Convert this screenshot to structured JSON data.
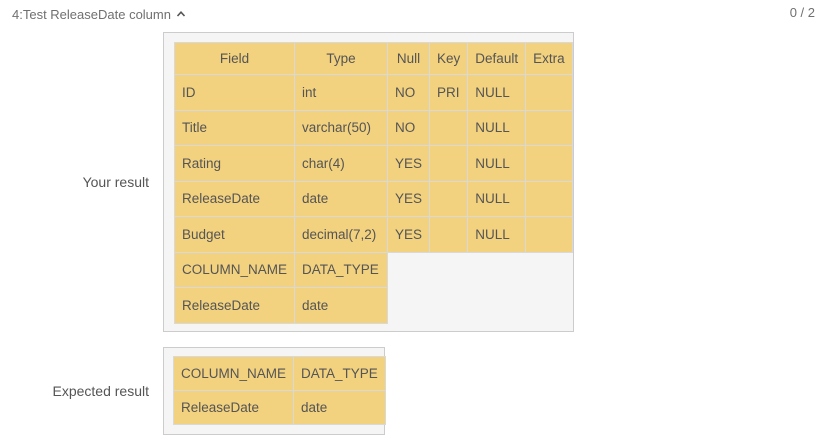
{
  "test": {
    "title": "4:Test ReleaseDate column",
    "score": "0 / 2"
  },
  "your_result": {
    "label": "Your result",
    "table1": {
      "headers": [
        "Field",
        "Type",
        "Null",
        "Key",
        "Default",
        "Extra"
      ],
      "rows": [
        [
          "ID",
          "int",
          "NO",
          "PRI",
          "NULL",
          ""
        ],
        [
          "Title",
          "varchar(50)",
          "NO",
          "",
          "NULL",
          ""
        ],
        [
          "Rating",
          "char(4)",
          "YES",
          "",
          "NULL",
          ""
        ],
        [
          "ReleaseDate",
          "date",
          "YES",
          "",
          "NULL",
          ""
        ],
        [
          "Budget",
          "decimal(7,2)",
          "YES",
          "",
          "NULL",
          ""
        ]
      ]
    },
    "table2": {
      "rows": [
        [
          "COLUMN_NAME",
          "DATA_TYPE"
        ],
        [
          "ReleaseDate",
          "date"
        ]
      ]
    }
  },
  "expected_result": {
    "label": "Expected result",
    "rows": [
      [
        "COLUMN_NAME",
        "DATA_TYPE"
      ],
      [
        "ReleaseDate",
        "date"
      ]
    ]
  },
  "icons": {
    "collapse": "chevron-up-icon"
  }
}
